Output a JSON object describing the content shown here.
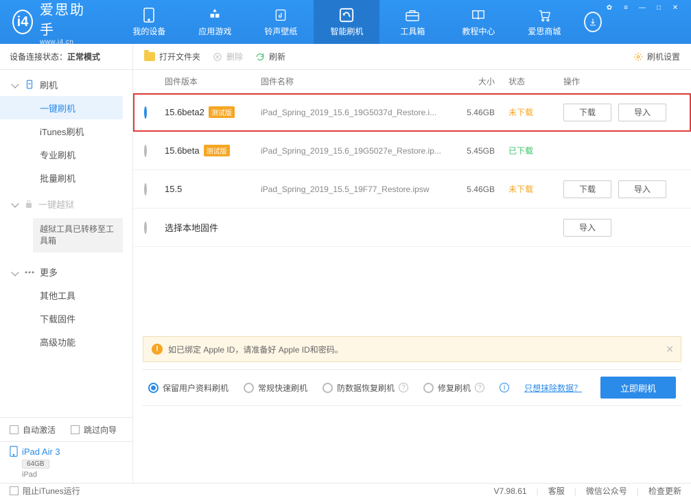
{
  "app": {
    "name": "爱思助手",
    "url": "www.i4.cn"
  },
  "nav": {
    "items": [
      {
        "label": "我的设备"
      },
      {
        "label": "应用游戏"
      },
      {
        "label": "铃声壁纸"
      },
      {
        "label": "智能刷机"
      },
      {
        "label": "工具箱"
      },
      {
        "label": "教程中心"
      },
      {
        "label": "爱思商城"
      }
    ],
    "active_index": 3
  },
  "connection": {
    "prefix": "设备连接状态：",
    "status": "正常模式"
  },
  "sidebar": {
    "groups": [
      {
        "title": "刷机",
        "items": [
          "一键刷机",
          "iTunes刷机",
          "专业刷机",
          "批量刷机"
        ],
        "selected": 0
      },
      {
        "title": "一键越狱",
        "note": "越狱工具已转移至工具箱",
        "locked": true
      },
      {
        "title": "更多",
        "items": [
          "其他工具",
          "下载固件",
          "高级功能"
        ]
      }
    ],
    "auto_activate": "自动激活",
    "skip_guide": "跳过向导"
  },
  "device": {
    "name": "iPad Air 3",
    "capacity": "64GB",
    "type": "iPad"
  },
  "toolbar": {
    "open": "打开文件夹",
    "delete": "删除",
    "refresh": "刷新",
    "settings": "刷机设置"
  },
  "columns": {
    "version": "固件版本",
    "name": "固件名称",
    "size": "大小",
    "status": "状态",
    "ops": "操作"
  },
  "firmware": [
    {
      "selected": true,
      "version": "15.6beta2",
      "beta": "测试版",
      "name": "iPad_Spring_2019_15.6_19G5037d_Restore.i...",
      "size": "5.46GB",
      "status": "未下载",
      "status_class": "orange",
      "ops": [
        "下载",
        "导入"
      ],
      "highlight": true
    },
    {
      "selected": false,
      "version": "15.6beta",
      "beta": "测试版",
      "name": "iPad_Spring_2019_15.6_19G5027e_Restore.ip...",
      "size": "5.45GB",
      "status": "已下载",
      "status_class": "green",
      "ops": []
    },
    {
      "selected": false,
      "version": "15.5",
      "beta": "",
      "name": "iPad_Spring_2019_15.5_19F77_Restore.ipsw",
      "size": "5.46GB",
      "status": "未下载",
      "status_class": "orange",
      "ops": [
        "下载",
        "导入"
      ]
    },
    {
      "selected": false,
      "version": "",
      "local_label": "选择本地固件",
      "ops": [
        "导入"
      ]
    }
  ],
  "alert": "如已绑定 Apple ID，请准备好 Apple ID和密码。",
  "flash_options": {
    "items": [
      "保留用户资料刷机",
      "常规快速刷机",
      "防数据恢复刷机",
      "修复刷机"
    ],
    "selected": 0,
    "erase_link": "只想抹除数据？",
    "go": "立即刷机"
  },
  "statusbar": {
    "block_itunes": "阻止iTunes运行",
    "version": "V7.98.61",
    "support": "客服",
    "wechat": "微信公众号",
    "update": "检查更新"
  }
}
